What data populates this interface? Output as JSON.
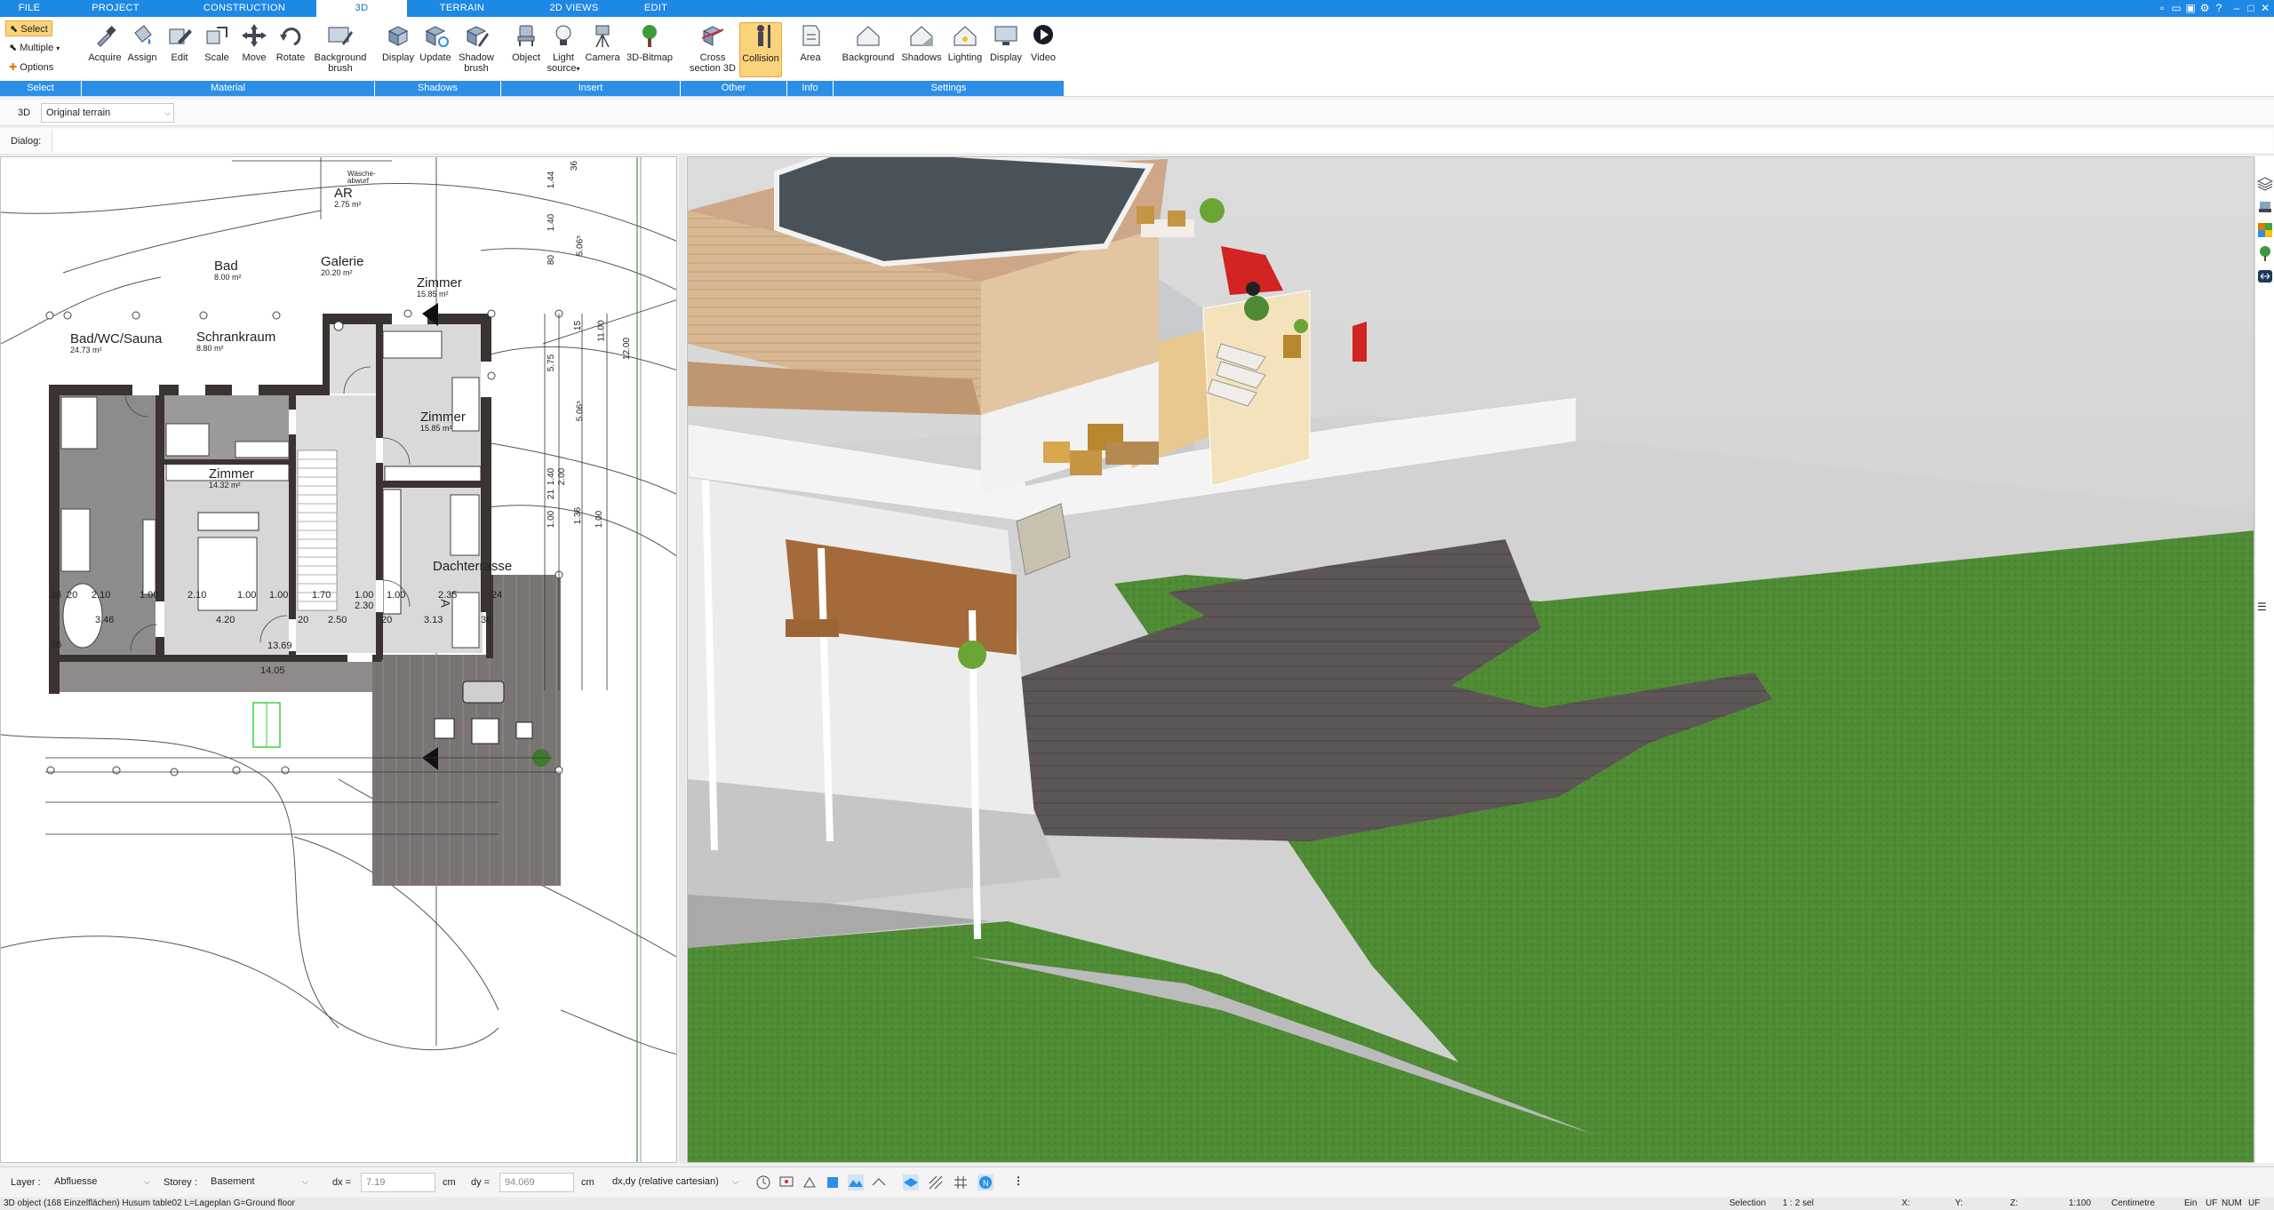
{
  "tabs": [
    {
      "label": "FILE",
      "active": false
    },
    {
      "label": "PROJECT",
      "active": false
    },
    {
      "label": "CONSTRUCTION",
      "active": false
    },
    {
      "label": "3D",
      "active": true
    },
    {
      "label": "TERRAIN",
      "active": false
    },
    {
      "label": "2D VIEWS",
      "active": false
    },
    {
      "label": "EDIT",
      "active": false
    }
  ],
  "ribbon": {
    "select": {
      "select": "Select",
      "multiple": "Multiple",
      "options": "Options"
    },
    "material": {
      "acquire": "Acquire",
      "assign": "Assign",
      "edit": "Edit",
      "scale": "Scale",
      "move": "Move",
      "rotate": "Rotate",
      "background_brush_1": "Background",
      "background_brush_2": "brush"
    },
    "shadows": {
      "display": "Display",
      "update": "Update",
      "shadow_brush_1": "Shadow",
      "shadow_brush_2": "brush"
    },
    "insert": {
      "object": "Object",
      "light_1": "Light",
      "light_2": "source",
      "camera": "Camera",
      "bitmap": "3D-Bitmap"
    },
    "other": {
      "cross_1": "Cross",
      "cross_2": "section 3D",
      "collision": "Collision"
    },
    "info": {
      "area": "Area"
    },
    "settings": {
      "background": "Background",
      "shadows": "Shadows",
      "lighting": "Lighting",
      "display": "Display",
      "video": "Video"
    },
    "groups": {
      "select": "Select",
      "material": "Material",
      "shadows": "Shadows",
      "insert": "Insert",
      "other": "Other",
      "info": "Info",
      "settings": "Settings"
    }
  },
  "toolbar": {
    "view_label": "3D",
    "terrain_value": "Original terrain",
    "dialog_label": "Dialog:"
  },
  "plan": {
    "rooms": [
      {
        "name": "AR",
        "area": "2.75 m²"
      },
      {
        "name": "Bad",
        "area": "8.00 m²"
      },
      {
        "name": "Galerie",
        "area": "20.20 m²"
      },
      {
        "name": "Zimmer",
        "area": "15.85 m²"
      },
      {
        "name": "Bad/WC/Sauna",
        "area": "24.73 m²"
      },
      {
        "name": "Schrankraum",
        "area": "8.80 m²"
      },
      {
        "name": "Zimmer",
        "area": "15.85 m²"
      },
      {
        "name": "Zimmer",
        "area": "14.32 m²"
      },
      {
        "name": "Dachterrasse",
        "area": ""
      }
    ],
    "waesche_1": "Wäsche-",
    "waesche_2": "abwurf",
    "section_mark": "A",
    "dims_top": [
      "80",
      "80"
    ],
    "dims_right": [
      "36",
      "1.44",
      "1.40",
      "80",
      "5.06⁵",
      "15",
      "5.75",
      "11.00",
      "12.00",
      "5.06⁵",
      "1.40",
      "2.00",
      "21",
      "1.36",
      "1.00",
      "1.00"
    ],
    "dims_bottom_row1": [
      "36",
      "20",
      "2.10",
      "1.00",
      "2.10",
      "1.00",
      "1.00",
      "1.70",
      "1.00",
      "1.00",
      "2.35",
      "24"
    ],
    "dims_bottom_row2": [
      "3.46",
      "4.20",
      "20",
      "2.50",
      "2.30",
      "20",
      "3.13",
      "36"
    ],
    "dims_bottom_row3": [
      "36",
      "13.69"
    ],
    "dims_bottom_row4": [
      "14.05"
    ]
  },
  "bottom": {
    "layer_label": "Layer :",
    "layer_value": "Abfluesse",
    "storey_label": "Storey :",
    "storey_value": "Basement",
    "dx_label": "dx =",
    "dx_value": "7.19",
    "dx_unit": "cm",
    "dy_label": "dy =",
    "dy_value": "94.069",
    "dy_unit": "cm",
    "coord_mode": "dx,dy (relative cartesian)"
  },
  "status": {
    "left": "3D object (168 Einzelflächen) Husum table02 L=Lageplan G=Ground floor",
    "selection": "Selection",
    "sel_value": "1 : 2 sel",
    "x": "X:",
    "y": "Y:",
    "z": "Z:",
    "scale": "1:100",
    "unit": "Centimetre",
    "ein": "Ein",
    "uf": "UF",
    "num": "NUM",
    "uf2": "UF"
  },
  "colors": {
    "accent": "#1e88e5",
    "ribbon_group": "#2b8fe8",
    "active_tool": "#fbd37a",
    "lawn": "#4e8a32",
    "roof": "#4a5259",
    "wood": "#d2b08a"
  }
}
